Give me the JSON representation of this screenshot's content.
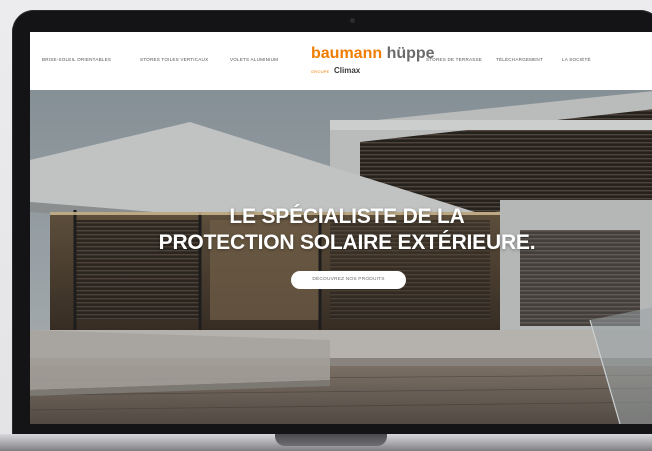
{
  "header": {
    "nav_left": [
      {
        "label": "BRISE-SOLEIL ORIENTABLES"
      },
      {
        "label": "STORES TOILES VERTICAUX"
      },
      {
        "label": "VOLETS ALUMINIUM"
      }
    ],
    "nav_right": [
      {
        "label": "STORES DE TERRASSE"
      },
      {
        "label": "TÉLÉCHARGEMENT"
      },
      {
        "label": "LA SOCIÉTÉ"
      }
    ],
    "logo": {
      "brand_part1": "baumann",
      "brand_part2": "hüppe",
      "group_text": "GROUPE",
      "sub_brand": "Climax"
    }
  },
  "hero": {
    "title_line1": "LE SPÉCIALISTE DE LA",
    "title_line2": "PROTECTION SOLAIRE EXTÉRIEURE.",
    "cta_label": "DÉCOUVREZ NOS PRODUITS"
  },
  "colors": {
    "brand_orange": "#f07d00",
    "brand_grey": "#6a6a6a",
    "device_frame": "#141416"
  }
}
